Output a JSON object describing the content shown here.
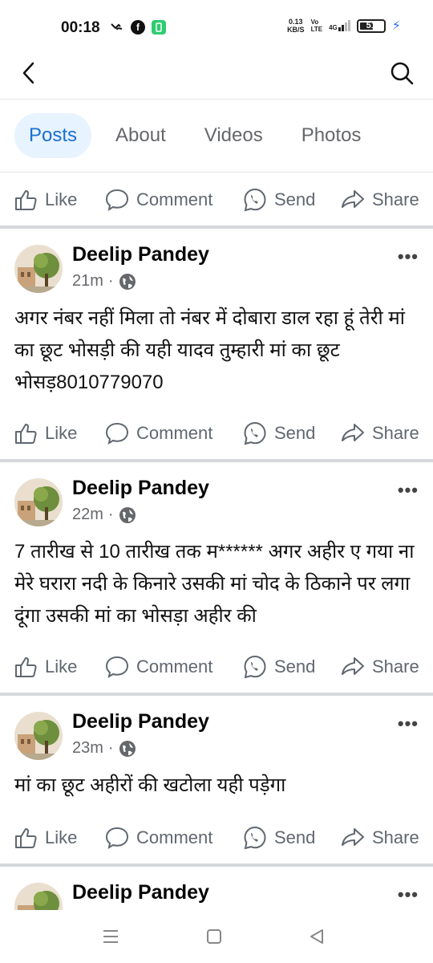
{
  "status": {
    "time": "00:18",
    "net_speed_top": "0.13",
    "net_speed_bottom": "KB/S",
    "lte_top": "Vo",
    "lte_bottom": "LTE",
    "signal_label": "4G",
    "battery": "51"
  },
  "tabs": [
    {
      "label": "Posts",
      "active": true
    },
    {
      "label": "About",
      "active": false
    },
    {
      "label": "Videos",
      "active": false
    },
    {
      "label": "Photos",
      "active": false
    }
  ],
  "actions": {
    "like": "Like",
    "comment": "Comment",
    "send": "Send",
    "share": "Share"
  },
  "posts": [
    {
      "author": "Deelip Pandey",
      "time": "21m",
      "dot": "·",
      "text": "अगर नंबर नहीं मिला तो नंबर में दोबारा डाल रहा हूं तेरी मां का छूट भोसड़ी की यही यादव तुम्हारी मां का छूट भोसड़8010779070"
    },
    {
      "author": "Deelip Pandey",
      "time": "22m",
      "dot": "·",
      "text": "7 तारीख से 10 तारीख तक म****** अगर अहीर ए गया ना मेरे घरारा नदी के किनारे उसकी मां चोद के ठिकाने पर लगा दूंगा उसकी मां का भोसड़ा अहीर की"
    },
    {
      "author": "Deelip Pandey",
      "time": "23m",
      "dot": "·",
      "text": "मां का छूट अहीरों की खटोला यही पड़ेगा"
    },
    {
      "author": "Deelip Pandey",
      "time": "",
      "dot": "",
      "text": ""
    }
  ],
  "colors": {
    "accent": "#1b6fd1",
    "tab_active_bg": "#e7f3ff",
    "muted": "#65676b"
  }
}
